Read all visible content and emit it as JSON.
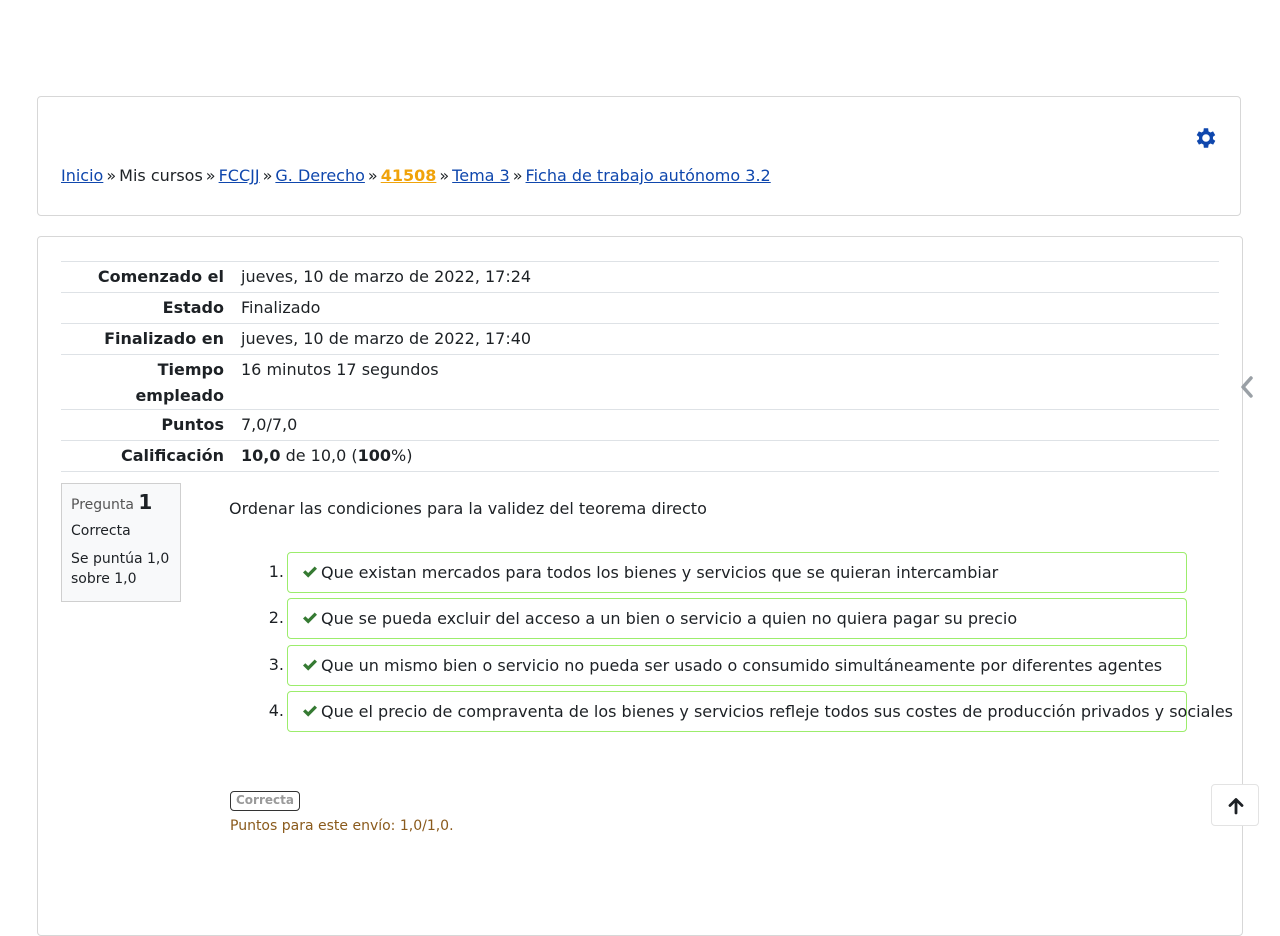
{
  "breadcrumb": {
    "items": [
      {
        "label": "Inicio",
        "link": true
      },
      {
        "label": "Mis cursos",
        "link": false
      },
      {
        "label": "FCCJJ",
        "link": true
      },
      {
        "label": "G. Derecho",
        "link": true
      },
      {
        "label": "41508",
        "link": true,
        "highlight": true
      },
      {
        "label": "Tema 3",
        "link": true
      },
      {
        "label": "Ficha de trabajo autónomo 3.2",
        "link": true
      }
    ],
    "separator": "»"
  },
  "summary": {
    "started_label": "Comenzado el",
    "started_value": "jueves, 10 de marzo de 2022, 17:24",
    "state_label": "Estado",
    "state_value": "Finalizado",
    "finished_label": "Finalizado en",
    "finished_value": "jueves, 10 de marzo de 2022, 17:40",
    "time_label_1": "Tiempo",
    "time_label_2": "empleado",
    "time_value": "16 minutos 17 segundos",
    "points_label": "Puntos",
    "points_value": "7,0/7,0",
    "grade_label": "Calificación",
    "grade_score": "10,0",
    "grade_mid": " de 10,0 (",
    "grade_percent": "100",
    "grade_end": "%)"
  },
  "question": {
    "label": "Pregunta",
    "number": "1",
    "state": "Correcta",
    "grade_line1": "Se puntúa 1,0",
    "grade_line2": "sobre 1,0",
    "text": "Ordenar las condiciones para la validez del teorema directo",
    "answers": [
      {
        "num": "1.",
        "text": "Que existan mercados para todos los bienes y servicios que se quieran intercambiar"
      },
      {
        "num": "2.",
        "text": "Que se pueda excluir del acceso a un bien o servicio a quien no quiera pagar su precio"
      },
      {
        "num": "3.",
        "text": "Que un mismo bien o servicio no pueda ser usado o consumido simultáneamente por diferentes agentes"
      },
      {
        "num": "4.",
        "text": "Que el precio de compraventa de los bienes y servicios refleje todos sus costes de producción privados y sociales"
      }
    ],
    "badge": "Correcta",
    "feedback": "Puntos para este envío: 1,0/1,0."
  },
  "colors": {
    "link": "#0f47ad",
    "highlight": "#f0a30a",
    "correct_border": "#9ced6c",
    "check": "#357a32",
    "feedback": "#8a5a1c"
  },
  "icons": {
    "settings": "gear-icon",
    "correct": "check-icon",
    "drawer": "chevron-left-icon",
    "scroll_top": "arrow-up-icon"
  }
}
